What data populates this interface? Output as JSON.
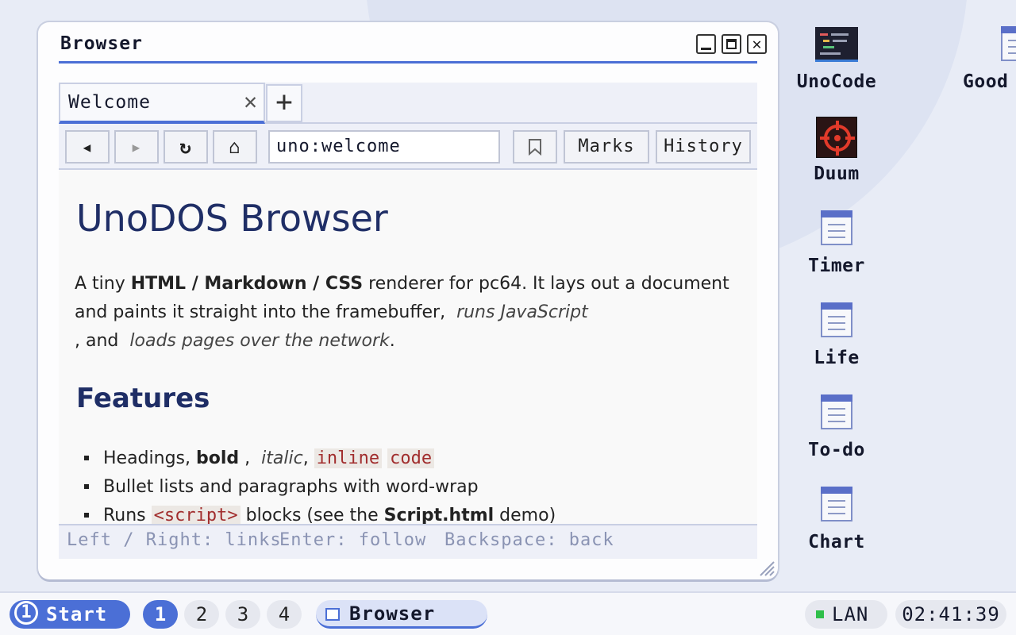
{
  "desktop": {
    "icons": [
      {
        "label": "UnoCode",
        "icon": "code-editor-icon"
      },
      {
        "label": "Duum",
        "icon": "crosshair-game-icon"
      },
      {
        "label": "Timer",
        "icon": "document-icon"
      },
      {
        "label": "Life",
        "icon": "document-icon"
      },
      {
        "label": "To-do",
        "icon": "document-icon"
      },
      {
        "label": "Chart",
        "icon": "document-icon"
      },
      {
        "label": "Good",
        "icon": "document-icon"
      }
    ]
  },
  "window": {
    "title": "Browser",
    "controls": {
      "minimize": "minimize-icon",
      "maximize": "maximize-icon",
      "close": "✕"
    }
  },
  "browser": {
    "tabs": [
      {
        "label": "Welcome",
        "close": "✕"
      }
    ],
    "new_tab": "+",
    "nav": {
      "back": "◀",
      "forward": "▶",
      "reload": "↻",
      "home": "⌂"
    },
    "url": "uno:welcome",
    "bookmark_icon": "bookmark-icon",
    "marks_label": "Marks",
    "history_label": "History"
  },
  "page": {
    "title": "UnoDOS Browser",
    "intro": {
      "t1": "A tiny ",
      "b1": "HTML / Markdown / CSS",
      "t2": " renderer for pc64. It lays out a document and paints it straight into the framebuffer,",
      "em1": "runs JavaScript",
      "t3": ", and",
      "em2": "loads pages over the network",
      "t4": "."
    },
    "features_heading": "Features",
    "features": [
      {
        "t1": "Headings, ",
        "b1": "bold",
        "t2": " , ",
        "em1": "italic",
        "t3": ", ",
        "c1": "inline",
        "c2": "code"
      },
      {
        "t1": "Bullet lists and paragraphs with word-wrap"
      },
      {
        "t1": "Runs ",
        "c1": "<script>",
        "t2": " blocks (see the ",
        "b1": "Script.html",
        "t3": " demo)"
      }
    ]
  },
  "statusbar": {
    "hint1": "Left / Right: links",
    "hint2": "Enter: follow",
    "hint3": "Backspace: back"
  },
  "taskbar": {
    "start_num": "1",
    "start_label": "Start",
    "workspaces": [
      "1",
      "2",
      "3",
      "4"
    ],
    "active_workspace": "1",
    "task_label": "Browser",
    "network_label": "LAN",
    "clock": "02:41:39"
  },
  "colors": {
    "accent": "#4b6fd6",
    "heading": "#1f2e66",
    "code": "#a12d2d",
    "status_ok": "#2fbf4a"
  }
}
